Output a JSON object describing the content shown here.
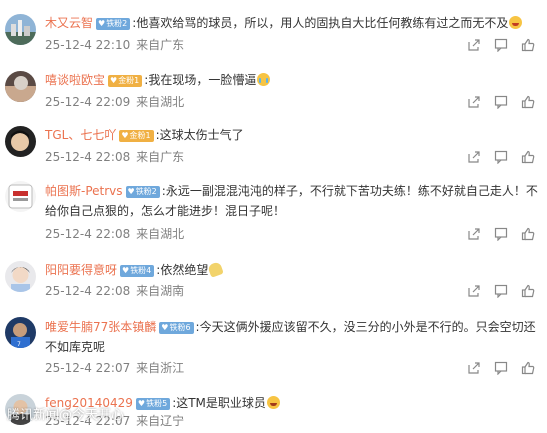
{
  "comments": [
    {
      "username": "木又云智",
      "badge": {
        "text": "铁粉2",
        "kind": "iron"
      },
      "text": ":他喜欢给骂的球员，所以，用人的固执自大比任何教练有过之而无不及",
      "emoji": "red",
      "date": "25-12-4 22:10",
      "location": "来自广东"
    },
    {
      "username": "嘻谈啦欧宝",
      "badge": {
        "text": "金粉1",
        "kind": "gold"
      },
      "text": ":我在现场，一脸懵逼",
      "emoji": "cry",
      "date": "25-12-4 22:09",
      "location": "来自湖北"
    },
    {
      "username": "TGL、七七吖",
      "badge": {
        "text": "金粉1",
        "kind": "gold"
      },
      "text": ":这球太伤士气了",
      "emoji": "",
      "date": "25-12-4 22:08",
      "location": "来自广东"
    },
    {
      "username": "帕图斯-Petrvs",
      "badge": {
        "text": "铁粉2",
        "kind": "iron"
      },
      "text": ":永远一副混混沌沌的样子，不行就下苦功夫练！练不好就自己走人！不给你自己点狠的，怎么才能进步！混日子呢！",
      "emoji": "",
      "date": "25-12-4 22:08",
      "location": "来自湖北"
    },
    {
      "username": "阳阳要得意呀",
      "badge": {
        "text": "铁粉4",
        "kind": "iron"
      },
      "text": ":依然绝望",
      "emoji": "ice",
      "date": "25-12-4 22:08",
      "location": "来自湖南"
    },
    {
      "username": "唯爱牛腩77张本镇麟",
      "badge": {
        "text": "铁粉6",
        "kind": "iron"
      },
      "text": ":今天这俩外援应该留不久，没三分的小外是不行的。只会空切还不如库克呢",
      "emoji": "",
      "date": "25-12-4 22:07",
      "location": "来自浙江"
    },
    {
      "username": "feng20140429",
      "badge": {
        "text": "铁粉5",
        "kind": "iron"
      },
      "text": ":这TM是职业球员",
      "emoji": "laugh",
      "date": "25-12-4 22:07",
      "location": "来自辽宁"
    }
  ],
  "colors": {
    "username": "#eb7350",
    "text": "#333333",
    "meta": "#808080",
    "badge_iron": "#6fa8dc",
    "badge_gold": "#f0b043"
  },
  "icons": {
    "share": "share-icon",
    "reply": "comment-icon",
    "like": "thumbs-up-icon"
  },
  "watermark": "腾讯新闻@今天开心"
}
